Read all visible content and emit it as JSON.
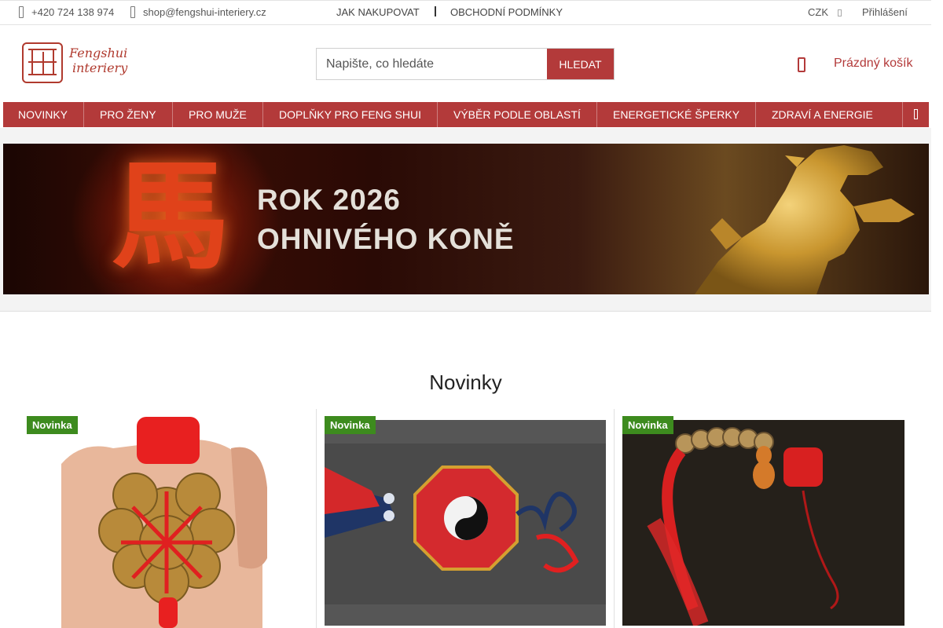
{
  "topbar": {
    "phone": "+420 724 138 974",
    "email": "shop@fengshui-interiery.cz",
    "links": [
      "JAK NAKUPOVAT",
      "OBCHODNÍ PODMÍNKY"
    ],
    "currency": "CZK",
    "login": "Přihlášení"
  },
  "header": {
    "logo_line1": "Fengshui",
    "logo_line2": "interiery",
    "search_placeholder": "Napište, co hledáte",
    "search_button": "HLEDAT",
    "cart_label": "Prázdný košík"
  },
  "menu": {
    "items": [
      "NOVINKY",
      "PRO ŽENY",
      "PRO MUŽE",
      "DOPLŇKY PRO FENG SHUI",
      "VÝBĚR PODLE OBLASTÍ",
      "ENERGETICKÉ ŠPERKY",
      "ZDRAVÍ A ENERGIE"
    ]
  },
  "banner": {
    "glyph": "馬",
    "line1": "ROK 2026",
    "line2": "OHNIVÉHO KONĚ"
  },
  "section": {
    "title": "Novinky",
    "products": [
      {
        "badge": "Novinka"
      },
      {
        "badge": "Novinka"
      },
      {
        "badge": "Novinka"
      }
    ]
  },
  "colors": {
    "accent": "#b33a3a",
    "badge": "#3d8b1e"
  }
}
